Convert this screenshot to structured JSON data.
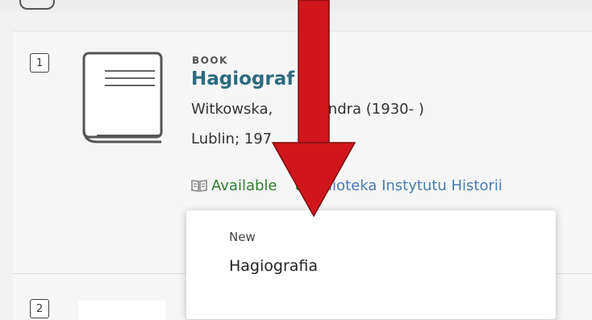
{
  "results": [
    {
      "number": "1",
      "type": "BOOK",
      "title": "Hagiograf",
      "author": "Witkowska,",
      "author_rest": "ksandra (1930- )",
      "publisher": "Lublin; 197",
      "availability_status": "Available",
      "availability_status_rest": "t",
      "availability_location": "Biblioteka Instytutu Historii"
    },
    {
      "number": "2"
    }
  ],
  "popup": {
    "label": "New",
    "value": "Hagiografia"
  },
  "colors": {
    "title": "#2e6a7d",
    "available": "#2e7d32",
    "location_link": "#4a7bb0",
    "annotation_arrow": "#d0161b"
  },
  "icons": {
    "book_thumbnail": "book-thumbnail-icon",
    "availability": "open-book-icon",
    "annotation": "red-down-arrow"
  }
}
